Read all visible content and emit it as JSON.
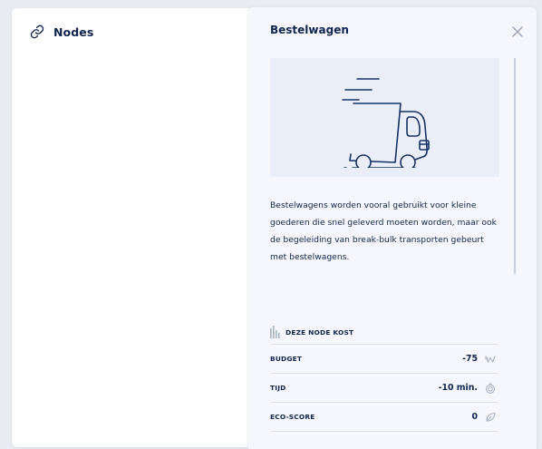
{
  "left_panel": {
    "title": "Nodes",
    "icon": "link-icon"
  },
  "detail": {
    "title": "Bestelwagen",
    "illustration": "delivery-van-icon",
    "description": "Bestelwagens worden vooral gebruikt voor kleine goederen die snel geleverd moeten worden, maar ook de begeleiding van break-bulk transporten gebeurt met bestelwagens.",
    "cost_header": "DEZE NODE KOST",
    "costs": [
      {
        "label": "BUDGET",
        "value": "-75",
        "icon": "budget-w-icon"
      },
      {
        "label": "TIJD",
        "value": "-10 min.",
        "icon": "stopwatch-icon"
      },
      {
        "label": "ECO-SCORE",
        "value": "0",
        "icon": "leaf-icon"
      }
    ]
  },
  "colors": {
    "text": "#0f2550",
    "panel_bg": "#f5f7fc",
    "illustration_bg": "#eaeef8",
    "icon_muted": "#a8b2c6"
  }
}
